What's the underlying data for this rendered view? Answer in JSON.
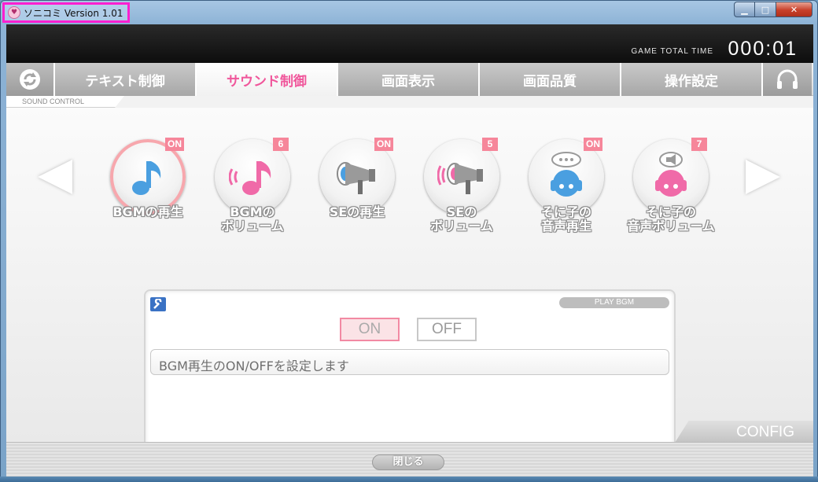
{
  "window": {
    "title": "ソニコミ Version 1.01",
    "controls": {
      "minimize": "▁",
      "maximize": "□",
      "close": "✕"
    }
  },
  "header": {
    "game_total_time_label": "GAME TOTAL TIME",
    "game_total_time_value": "000:01"
  },
  "tabs": [
    {
      "label": "テキスト制御",
      "active": false
    },
    {
      "label": "サウンド制御",
      "active": true
    },
    {
      "label": "画面表示",
      "active": false
    },
    {
      "label": "画面品質",
      "active": false
    },
    {
      "label": "操作設定",
      "active": false
    }
  ],
  "sub_label": "SOUND CONTROL",
  "items": [
    {
      "label": "BGMの再生",
      "badge": "ON",
      "icon": "music-note-icon",
      "selected": true
    },
    {
      "label": "BGMの\nボリューム",
      "badge": "6",
      "icon": "music-volume-icon",
      "selected": false
    },
    {
      "label": "SEの再生",
      "badge": "ON",
      "icon": "megaphone-icon",
      "selected": false
    },
    {
      "label": "SEの\nボリューム",
      "badge": "5",
      "icon": "megaphone-volume-icon",
      "selected": false
    },
    {
      "label": "そに子の\n音声再生",
      "badge": "ON",
      "icon": "sonico-voice-icon",
      "selected": false
    },
    {
      "label": "そに子の\n音声ボリューム",
      "badge": "7",
      "icon": "sonico-voice-volume-icon",
      "selected": false
    }
  ],
  "panel": {
    "tag": "PLAY BGM",
    "on_label": "ON",
    "off_label": "OFF",
    "selected": "ON",
    "description": "BGM再生のON/OFFを設定します"
  },
  "config_label": "CONFIG",
  "close_button": "閉じる",
  "colors": {
    "accent_pink": "#f0569b",
    "badge_pink": "#f6869a",
    "blue_icon": "#4a9fe0",
    "pink_icon": "#f06aa8"
  }
}
